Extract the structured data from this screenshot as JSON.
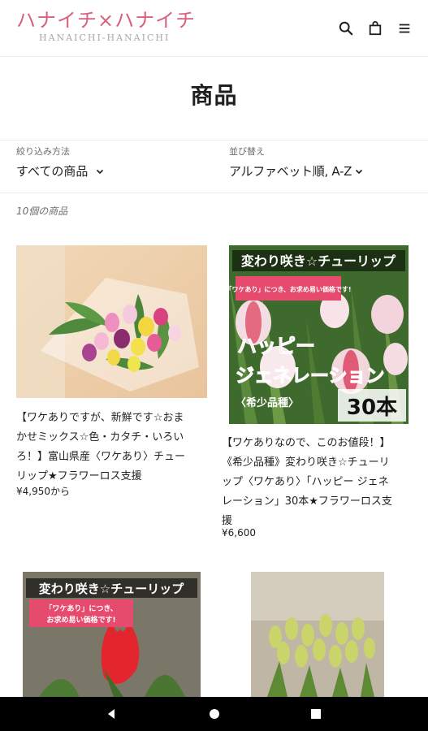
{
  "header": {
    "logo_jp": "ハナイチ×ハナイチ",
    "logo_en": "HANAICHI-HANAICHI",
    "icons": [
      "search-icon",
      "bag-icon",
      "menu-icon"
    ]
  },
  "page": {
    "title": "商品"
  },
  "filters": {
    "filter_label": "絞り込み方法",
    "filter_value": "すべての商品",
    "sort_label": "並び替え",
    "sort_value": "アルファベット順, A-Z"
  },
  "product_count": "10個の商品",
  "products": [
    {
      "title_lines": [
        "【ワケありですが、新鮮です☆おま",
        "かせミックス☆色・カタチ・いろい",
        "ろ！】富山県産〈ワケあり〉チュー",
        "リップ★フラワーロス支援"
      ],
      "price": "¥4,950から"
    },
    {
      "image_text": {
        "line1": "変わり咲き☆チューリップ",
        "badge": "「ワケあり」につき、お求め易い価格です!",
        "line2": "ハッピー",
        "line3": "ジェネレーション",
        "line4": "〈希少品種〉",
        "line5": "30本"
      },
      "title_lines": [
        "【ワケありなので、このお値段！】",
        "《希少品種》変わり咲き☆チューリ",
        "ップ〈ワケあり〉「ハッピー ジェネ",
        "レーション」30本★フラワーロス支",
        "援"
      ],
      "price": "¥6,600"
    },
    {
      "image_text": {
        "line1": "変わり咲き☆チューリップ",
        "badge1": "「ワケあり」につき、",
        "badge2": "お求め易い価格です!"
      }
    },
    {}
  ],
  "colors": {
    "brand_pink": "#d9617d",
    "text": "#1f1f1f",
    "muted": "#6b6b6b"
  }
}
